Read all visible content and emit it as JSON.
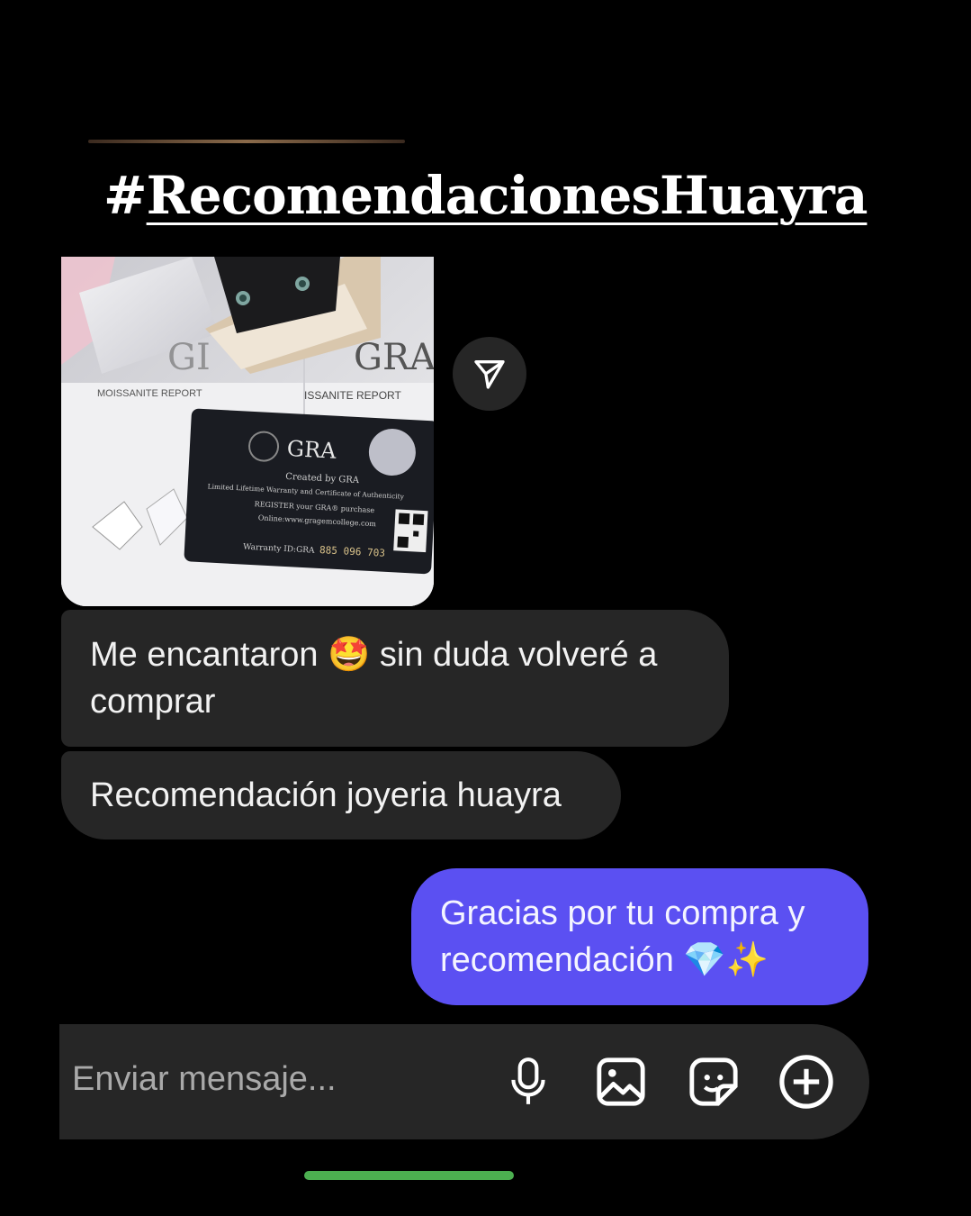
{
  "header": {
    "hash_sign": "#",
    "hashtag_text": "RecomendacionesHuayra"
  },
  "photo": {
    "report_left": "MOISSANITE REPORT",
    "report_right": "ISSANITE REPORT",
    "card_brand": "GRA",
    "card_created": "Created by GRA",
    "card_line1": "Limited Lifetime Warranty and Certificate of Authenticity",
    "card_line2": "REGISTER your GRA® purchase",
    "card_line3": "Online:www.gragemcollege.com",
    "card_warranty_label": "Warranty ID:GRA",
    "card_warranty_number": "885 096 703",
    "box_gra_left": "GI",
    "box_gra_right": "GRA"
  },
  "messages": {
    "received_1": "Me encantaron 🤩 sin duda volveré a comprar",
    "received_2": "Recomendación joyeria huayra",
    "sent_1": "Gracias por tu compra y recomendación 💎✨"
  },
  "composer": {
    "placeholder": "Enviar mensaje...",
    "icons": [
      "microphone-icon",
      "image-icon",
      "sticker-icon",
      "plus-circle-icon"
    ]
  },
  "colors": {
    "background": "#000000",
    "received_bubble": "#262626",
    "sent_bubble": "#5b50f2",
    "home_indicator": "#4caf50"
  }
}
